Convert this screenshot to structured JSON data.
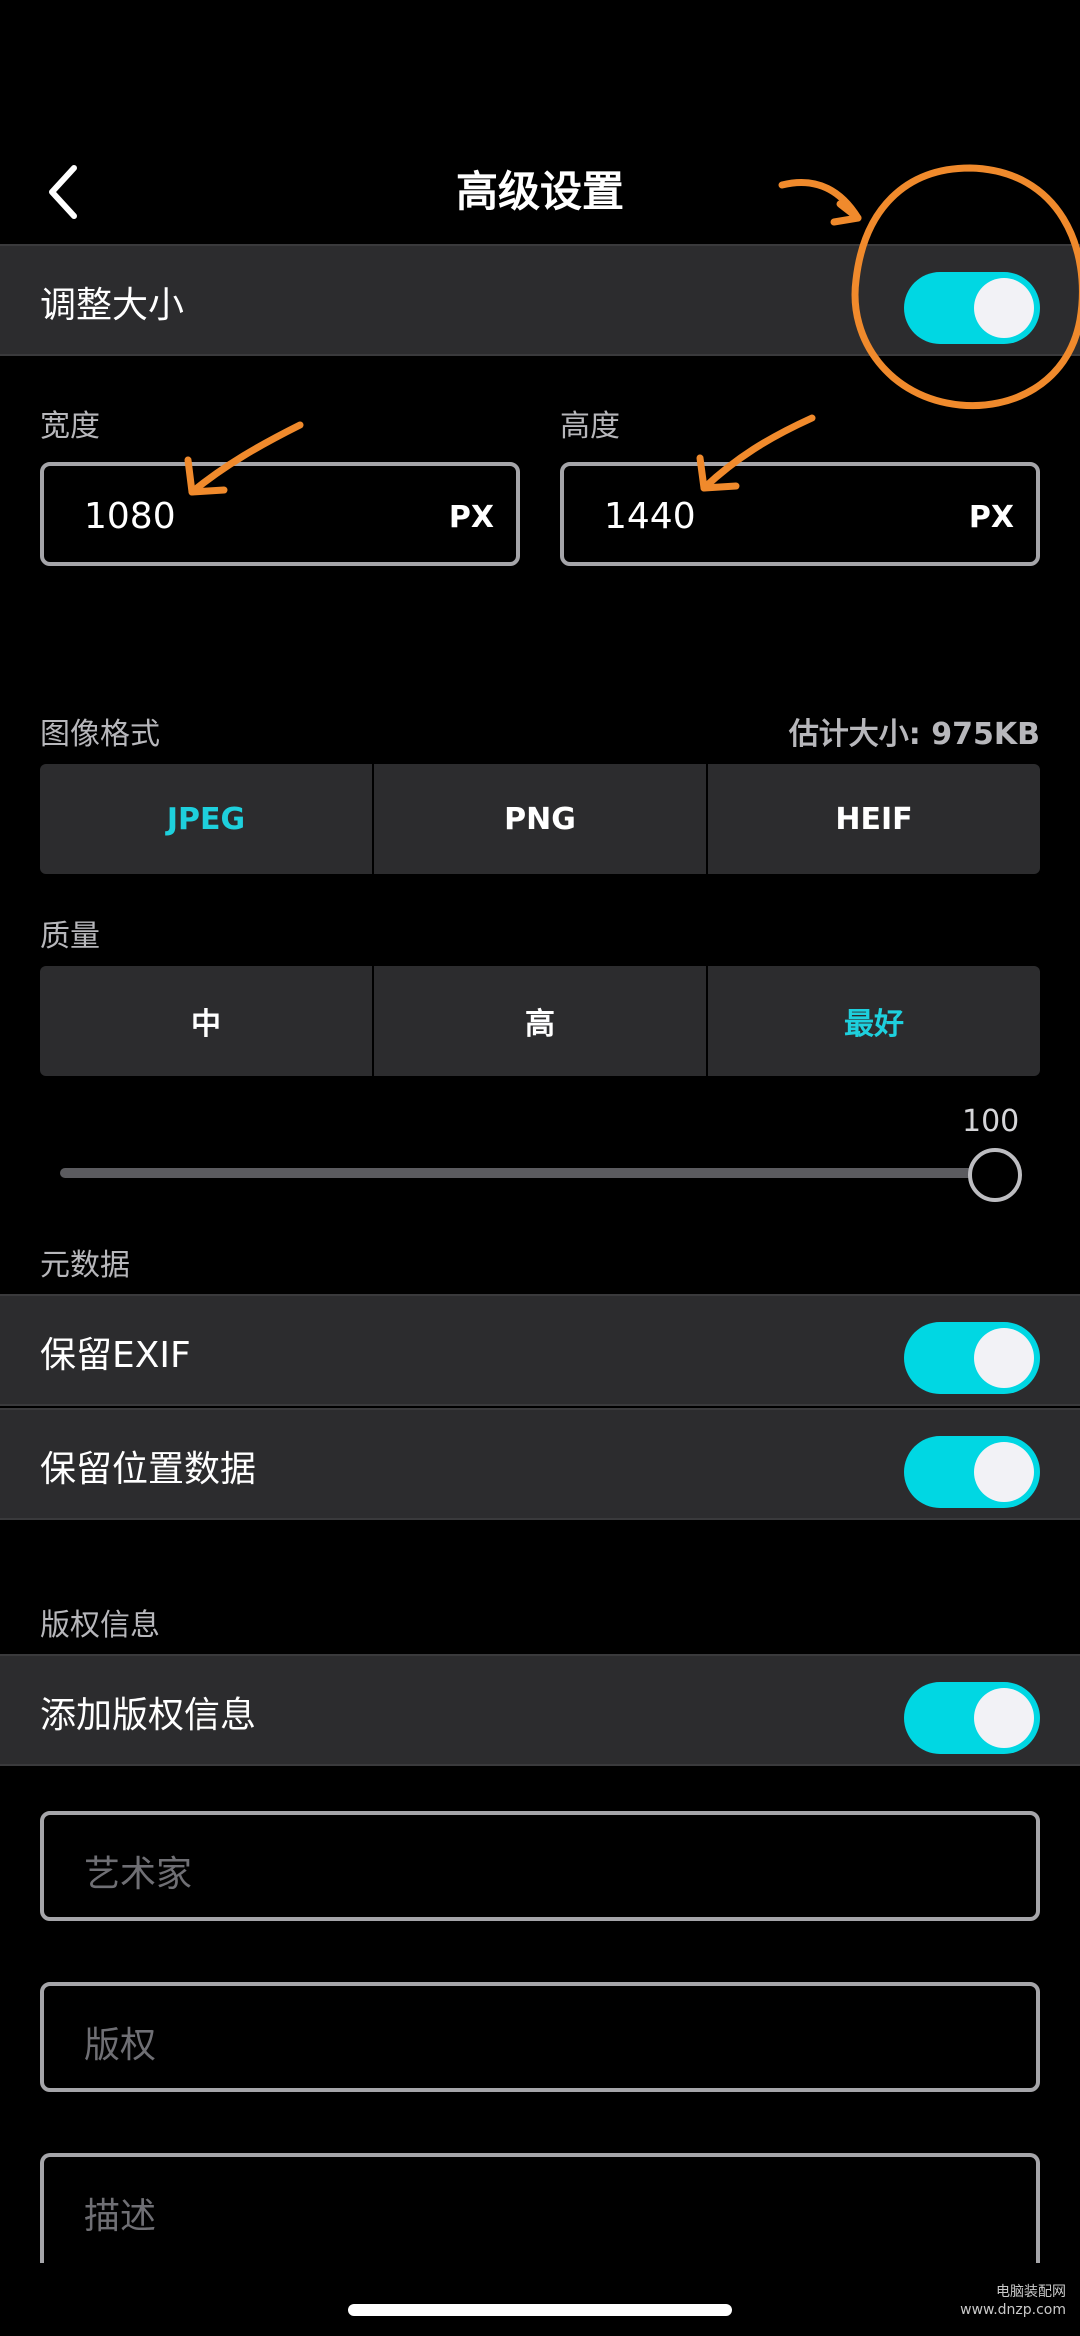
{
  "header": {
    "title": "高级设置"
  },
  "resize": {
    "label": "调整大小",
    "on": true
  },
  "dimensions": {
    "width_label": "宽度",
    "width_value": "1080",
    "height_label": "高度",
    "height_value": "1440",
    "unit": "PX"
  },
  "format": {
    "label": "图像格式",
    "estimate": "估计大小: 975KB",
    "options": [
      "JPEG",
      "PNG",
      "HEIF"
    ],
    "selected": "JPEG"
  },
  "quality": {
    "label": "质量",
    "options": [
      "中",
      "高",
      "最好"
    ],
    "selected": "最好",
    "slider_value": "100"
  },
  "metadata": {
    "label": "元数据",
    "keep_exif": "保留EXIF",
    "keep_location": "保留位置数据"
  },
  "copyright": {
    "label": "版权信息",
    "add": "添加版权信息",
    "artist_placeholder": "艺术家",
    "copyright_placeholder": "版权",
    "description_placeholder": "描述"
  },
  "watermark": {
    "line1": "电脑装配网",
    "line2": "www.dnzp.com"
  },
  "colors": {
    "accent": "#00d7e3",
    "annotation": "#f08a2c",
    "background": "#000000",
    "row": "#2c2c2e"
  }
}
